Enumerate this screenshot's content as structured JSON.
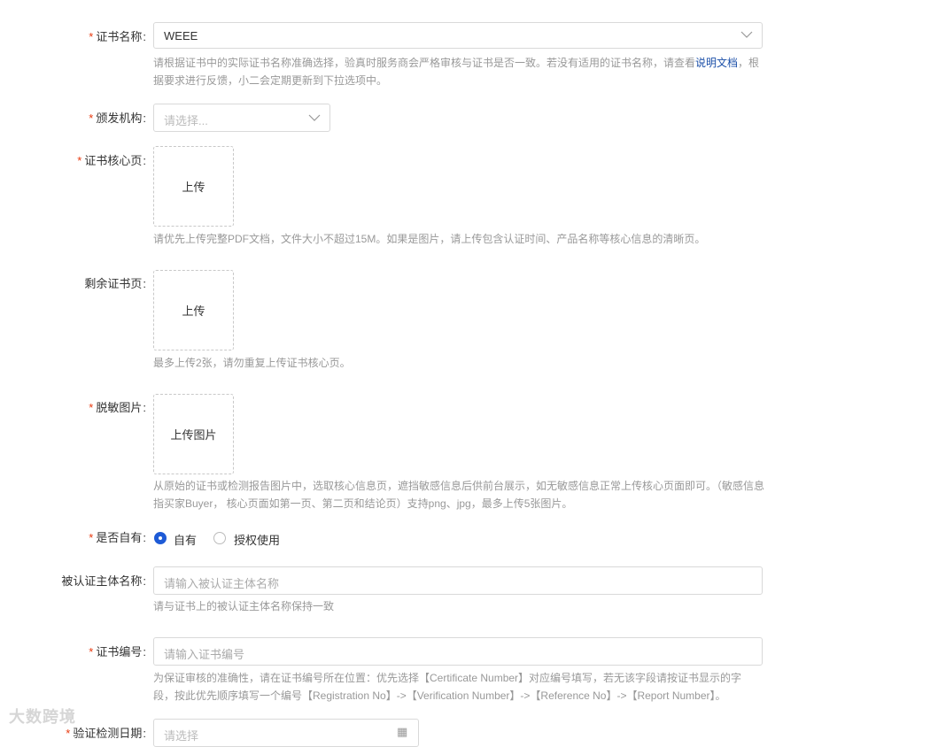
{
  "cert_name": {
    "label": "证书名称",
    "value": "WEEE",
    "hint_pre": "请根据证书中的实际证书名称准确选择，验真时服务商会严格审核与证书是否一致。若没有适用的证书名称，请查看",
    "hint_link": "说明文档",
    "hint_post": "，根据要求进行反馈，小二会定期更新到下拉选项中。"
  },
  "issuer": {
    "label": "颁发机构",
    "placeholder": "请选择..."
  },
  "core_page": {
    "label": "证书核心页",
    "upload_label": "上传",
    "hint": "请优先上传完整PDF文档，文件大小不超过15M。如果是图片，请上传包含认证时间、产品名称等核心信息的清晰页。"
  },
  "other_pages": {
    "label": "剩余证书页",
    "upload_label": "上传",
    "hint": "最多上传2张，请勿重复上传证书核心页。"
  },
  "masked_image": {
    "label": "脱敏图片",
    "upload_label": "上传图片",
    "hint": "从原始的证书或检测报告图片中，选取核心信息页，遮挡敏感信息后供前台展示，如无敏感信息正常上传核心页面即可。（敏感信息指买家Buyer， 核心页面如第一页、第二页和结论页）支持png、jpg，最多上传5张图片。"
  },
  "ownership": {
    "label": "是否自有",
    "options": [
      "自有",
      "授权使用"
    ],
    "selected": "自有"
  },
  "subject_name": {
    "label": "被认证主体名称",
    "placeholder": "请输入被认证主体名称",
    "hint": "请与证书上的被认证主体名称保持一致"
  },
  "cert_number": {
    "label": "证书编号",
    "placeholder": "请输入证书编号",
    "hint": "为保证审核的准确性，请在证书编号所在位置：优先选择【Certificate Number】对应编号填写，若无该字段请按证书显示的字段，按此优先顺序填写一个编号【Registration No】->【Verification Number】->【Reference No】->【Report Number】。"
  },
  "test_date": {
    "label": "验证检测日期",
    "placeholder": "请选择"
  },
  "watermark": "大数跨境",
  "colors": {
    "required": "#e8380d",
    "accent": "#1e5bd6",
    "link": "#1b4fa8"
  }
}
